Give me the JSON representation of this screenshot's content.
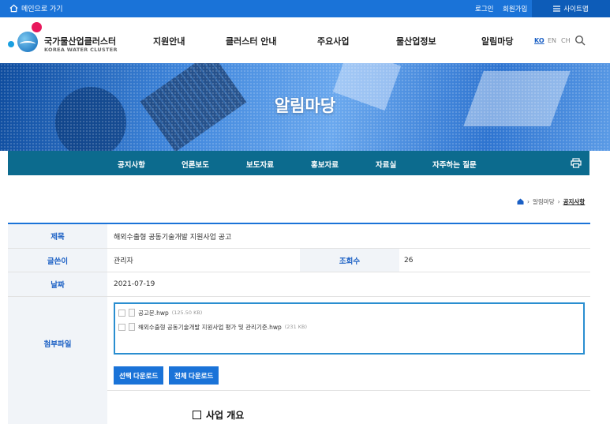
{
  "topbar": {
    "home_label": "메인으로 가기",
    "login": "로그인",
    "join": "회원가입",
    "sitemap": "사이트맵"
  },
  "logo": {
    "name_ko": "국가물산업클러스터",
    "name_en": "KOREA WATER CLUSTER"
  },
  "gnb": [
    "지원안내",
    "클러스터 안내",
    "주요사업",
    "물산업정보",
    "알림마당"
  ],
  "lang": [
    "KO",
    "EN",
    "CH"
  ],
  "hero": {
    "title": "알림마당"
  },
  "subnav": [
    "공지사항",
    "언론보도",
    "보도자료",
    "홍보자료",
    "자료실",
    "자주하는 질문"
  ],
  "breadcrumb": {
    "parent": "알림마당",
    "current": "공지사항"
  },
  "post": {
    "title_label": "제목",
    "title_value": "해외수출형 공동기술개발 지원사업 공고",
    "author_label": "글쓴이",
    "author_value": "관리자",
    "views_label": "조회수",
    "views_value": "26",
    "date_label": "날짜",
    "date_value": "2021-07-19",
    "files_label": "첨부파일",
    "files": [
      {
        "name": "공고문.hwp",
        "size": "(125.50 KB)"
      },
      {
        "name": "해외수출형 공동기술개발 지원사업 평가 및 관리기준.hwp",
        "size": "(231 KB)"
      }
    ],
    "btn_selected": "선택 다운로드",
    "btn_all": "전체 다운로드",
    "section_heading": "사업 개요"
  }
}
